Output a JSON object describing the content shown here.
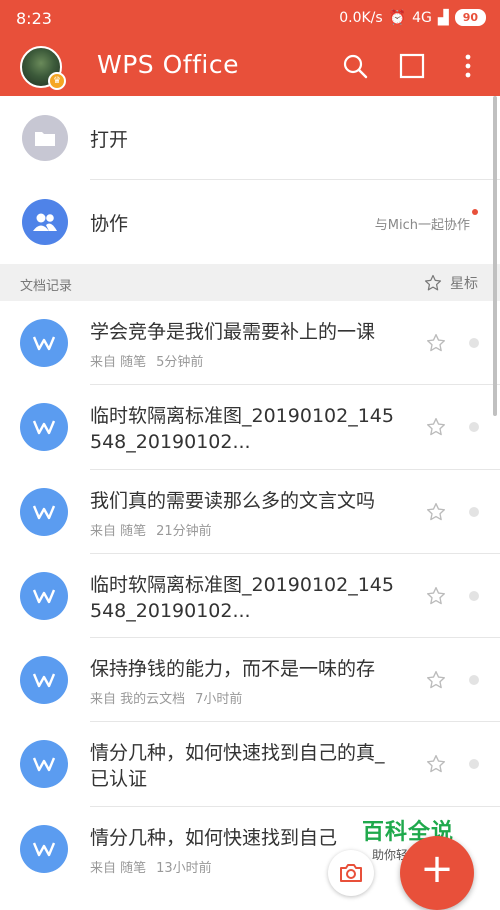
{
  "status_bar": {
    "time": "8:23",
    "network_speed": "0.0K/s",
    "signal": "4G",
    "battery": "90",
    "icons": [
      "alarm-icon",
      "hd-signal-icon",
      "battery-icon"
    ]
  },
  "app_bar": {
    "title": "WPS Office",
    "icons": [
      "search-icon",
      "multiwindow-icon",
      "more-vert-icon"
    ],
    "accent": "#e8503a"
  },
  "actions": [
    {
      "label": "打开",
      "icon": "folder-icon",
      "color": "#c7c7d3"
    },
    {
      "label": "协作",
      "icon": "people-icon",
      "color": "#4f83e8",
      "hint": "与Mich一起协作"
    }
  ],
  "section": {
    "title": "文档记录",
    "star_label": "星标"
  },
  "documents": [
    {
      "name": "学会竞争是我们最需要补上的一课",
      "source": "来自 随笔",
      "time": "5分钟前"
    },
    {
      "name": "临时软隔离标准图_20190102_145548_20190102...",
      "source": "",
      "time": ""
    },
    {
      "name": "我们真的需要读那么多的文言文吗",
      "source": "来自 随笔",
      "time": "21分钟前"
    },
    {
      "name": "临时软隔离标准图_20190102_145548_20190102...",
      "source": "",
      "time": ""
    },
    {
      "name": "保持挣钱的能力，而不是一味的存",
      "source": "来自 我的云文档",
      "time": "7小时前"
    },
    {
      "name": "情分几种，如何快速找到自己的真_已认证",
      "source": "",
      "time": ""
    },
    {
      "name": "情分几种，如何快速找到自己",
      "source": "来自 随笔",
      "time": "13小时前"
    }
  ],
  "watermark": {
    "brand": "百科全说",
    "slogan": "助你轻松解决"
  },
  "fab": {
    "label": "+"
  }
}
